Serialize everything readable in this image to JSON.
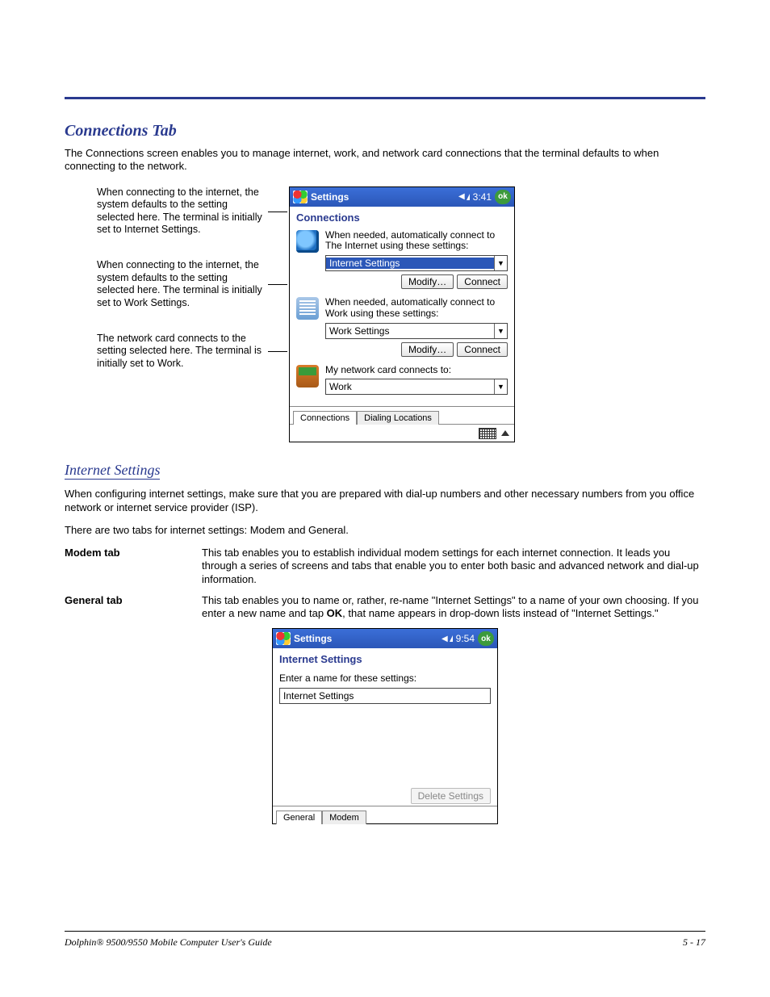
{
  "section_title": "Connections Tab",
  "intro": "The Connections screen enables you to manage internet, work, and network card connections that the terminal defaults to when connecting to the network.",
  "callout1": "When connecting to the internet, the system defaults to the setting selected here. The terminal is initially set to Internet Settings.",
  "callout2": "When connecting to the internet, the system defaults to the setting selected here. The terminal is initially set to Work Settings.",
  "callout3": "The network card connects to the setting selected here. The terminal is initially set to Work.",
  "device1": {
    "title": "Settings",
    "time": "3:41",
    "ok": "ok",
    "subtitle": "Connections",
    "sec1_text": "When needed, automatically connect to The Internet using these settings:",
    "sec1_dd": "Internet Settings",
    "sec2_text": "When needed, automatically connect to Work using these settings:",
    "sec2_dd": "Work Settings",
    "sec3_text": "My network card connects to:",
    "sec3_dd": "Work",
    "modify": "Modify…",
    "connect": "Connect",
    "tab1": "Connections",
    "tab2": "Dialing Locations"
  },
  "subheading": "Internet Settings",
  "is_para1": "When configuring internet settings, make sure that you are prepared with dial-up numbers and other necessary numbers from you office network or internet service provider (ISP).",
  "is_para2": "There are two tabs for internet settings: Modem and General.",
  "modem_term": "Modem tab",
  "modem_desc": "This tab enables you to establish individual modem settings for each internet connection. It leads you through a series of screens and tabs that enable you to enter both basic and advanced network and dial-up information.",
  "general_term": "General tab",
  "general_desc_a": "This tab enables you to name or, rather, re-name \"Internet Settings\" to a name of your own choosing. If you enter a new name and tap ",
  "general_desc_b": "OK",
  "general_desc_c": ", that name appears in drop-down lists instead of \"Internet Settings.\"",
  "device2": {
    "title": "Settings",
    "time": "9:54",
    "ok": "ok",
    "subtitle": "Internet Settings",
    "prompt": "Enter a name for these settings:",
    "name_value": "Internet Settings",
    "delete": "Delete Settings",
    "tab1": "General",
    "tab2": "Modem"
  },
  "footer_left": "Dolphin® 9500/9550 Mobile Computer User's Guide",
  "footer_right": "5 - 17"
}
